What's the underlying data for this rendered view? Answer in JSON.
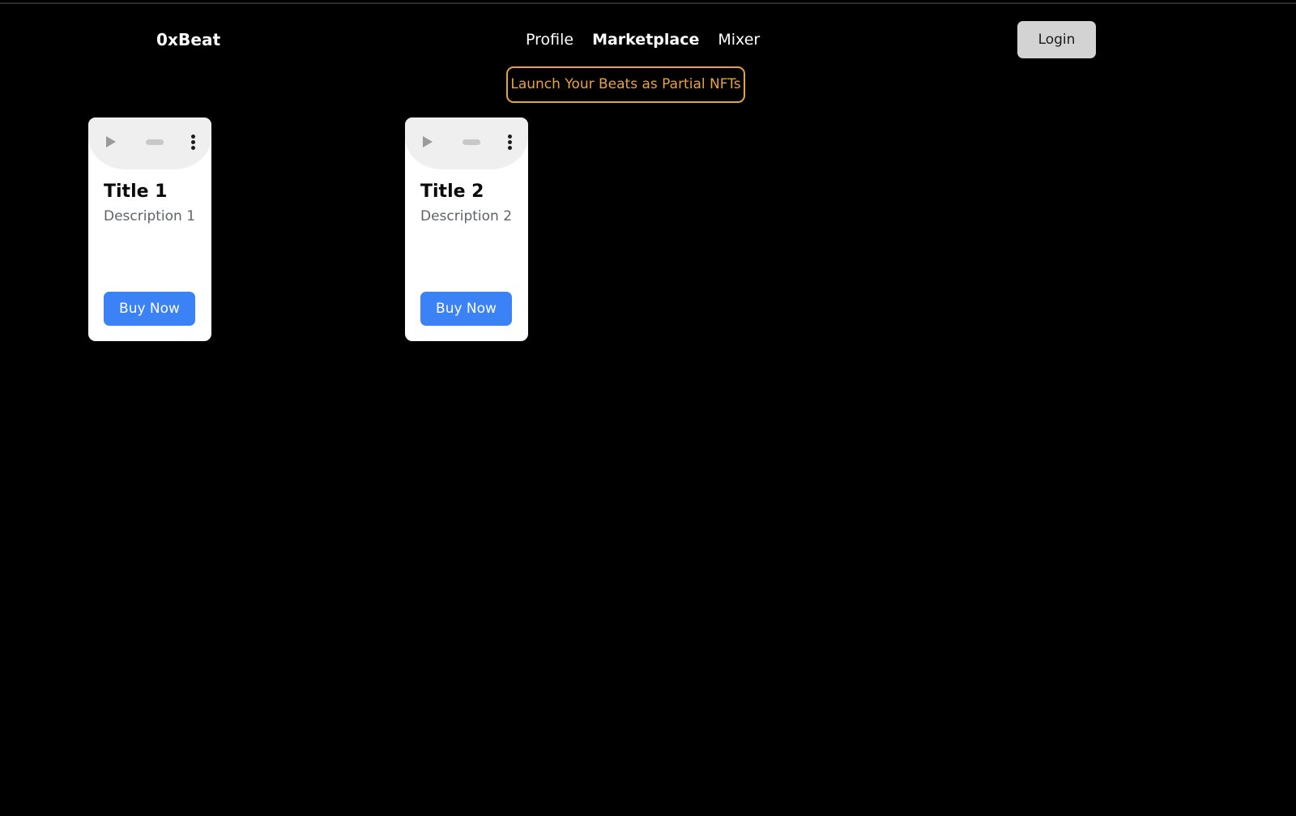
{
  "page": {
    "background_color": "#000000",
    "title": "0xBeat Marketplace"
  },
  "header": {
    "brand": "0xBeat",
    "nav": [
      {
        "label": "Profile",
        "active": false
      },
      {
        "label": "Marketplace",
        "active": true
      },
      {
        "label": "Mixer",
        "active": false
      }
    ],
    "login_label": "Login",
    "login_bg_color": "#d3d3d3"
  },
  "cta": {
    "label": "Launch Your Beats as Partial NFTs",
    "accent_color": "#e8a33d"
  },
  "cards": [
    {
      "title": "Title 1",
      "description": "Description 1",
      "buy_label": "Buy Now",
      "player": {
        "play_icon": "play-icon",
        "timeline_icon": "timeline-scrubber",
        "menu_icon": "overflow-menu-icon"
      }
    },
    {
      "title": "Title 2",
      "description": "Description 2",
      "buy_label": "Buy Now",
      "player": {
        "play_icon": "play-icon",
        "timeline_icon": "timeline-scrubber",
        "menu_icon": "overflow-menu-icon"
      }
    }
  ],
  "colors": {
    "buy_button": "#3b82f6",
    "card_bg": "#ffffff",
    "player_bg": "#efefef",
    "title_text": "#0a0a0a",
    "description_text": "#5f6368"
  }
}
